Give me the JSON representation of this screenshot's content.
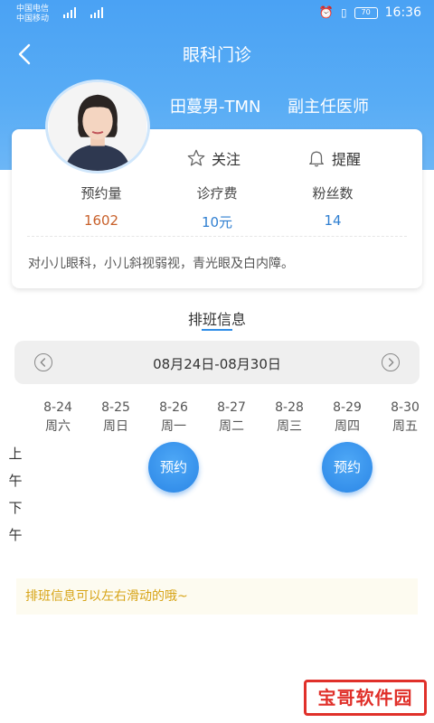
{
  "status_bar": {
    "carrier1": "中国电信",
    "carrier2": "中国移动",
    "time": "16:36",
    "battery": "70"
  },
  "nav": {
    "title": "眼科门诊"
  },
  "doctor": {
    "name": "田蔓男-TMN",
    "title": "副主任医师"
  },
  "actions": {
    "follow_label": "关注",
    "remind_label": "提醒"
  },
  "stats": [
    {
      "label": "预约量",
      "value": "1602",
      "color": "#c8602a"
    },
    {
      "label": "诊疗费",
      "value": "10元",
      "color": "#2f7fd1"
    },
    {
      "label": "粉丝数",
      "value": "14",
      "color": "#2f7fd1"
    }
  ],
  "description": "对小儿眼科，小儿斜视弱视，青光眼及白内障。",
  "schedule": {
    "title": "排班信息",
    "week_range": "08月24日-08月30日",
    "days": [
      {
        "date": "8-24",
        "weekday": "周六"
      },
      {
        "date": "8-25",
        "weekday": "周日"
      },
      {
        "date": "8-26",
        "weekday": "周一"
      },
      {
        "date": "8-27",
        "weekday": "周二"
      },
      {
        "date": "8-28",
        "weekday": "周三"
      },
      {
        "date": "8-29",
        "weekday": "周四"
      },
      {
        "date": "8-30",
        "weekday": "周五"
      }
    ],
    "morning_label": [
      "上",
      "午"
    ],
    "afternoon_label": [
      "下",
      "午"
    ],
    "book_label": "预约",
    "tip": "排班信息可以左右滑动的哦~"
  },
  "watermark": "宝哥软件园",
  "colors": {
    "header": "#4aa2f4",
    "accent": "#2f8ee8",
    "tip_text": "#d7a417"
  }
}
